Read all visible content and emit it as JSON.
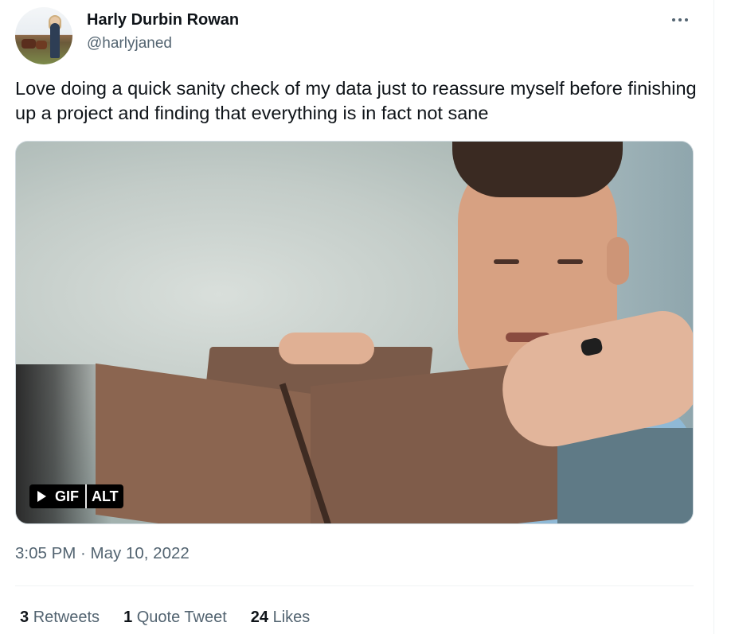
{
  "tweet": {
    "author_name": "Harly Durbin Rowan",
    "author_handle": "@harlyjaned",
    "text": "Love doing a quick sanity check of my data just to reassure myself before finishing up a project and finding that everything is in fact not sane",
    "media": {
      "badge_gif": "GIF",
      "badge_alt": "ALT"
    },
    "timestamp": "3:05 PM · May 10, 2022",
    "stats": {
      "retweets_count": "3",
      "retweets_label": "Retweets",
      "quotes_count": "1",
      "quotes_label": "Quote Tweet",
      "likes_count": "24",
      "likes_label": "Likes"
    },
    "icons": [
      "more-options-icon",
      "play-icon"
    ]
  }
}
